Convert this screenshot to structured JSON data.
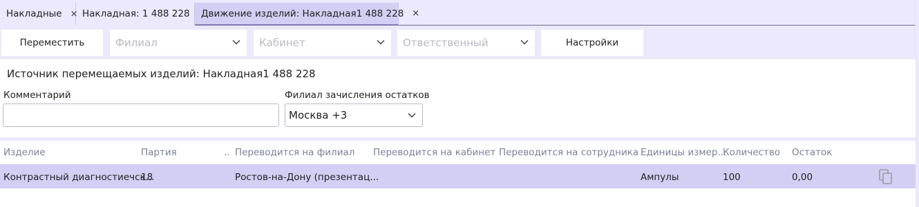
{
  "tabs": [
    {
      "label": "Накладные",
      "close": "×"
    },
    {
      "label": "Накладная: 1 488 228",
      "close": "×"
    },
    {
      "label": "Движение изделий: Накладная1 488 228",
      "close": "×"
    }
  ],
  "toolbar": {
    "move_label": "Переместить",
    "branch_placeholder": "Филиал",
    "cabinet_placeholder": "Кабинет",
    "responsible_placeholder": "Ответственный",
    "settings_label": "Настройки"
  },
  "form": {
    "source_line": "Источник перемещаемых изделий: Накладная1 488 228",
    "comment_label": "Комментарий",
    "comment_value": "",
    "branch_label": "Филиал зачисления остатков",
    "branch_value": "Москва +3"
  },
  "table": {
    "columns": [
      "Изделие",
      "Партия",
      "..",
      "Переводится на филиал",
      "Переводится на кабинет",
      "Переводится на сотрудника",
      "Единицы измер...",
      "Количество",
      "Остаток"
    ],
    "rows": [
      {
        "product": "Контрастный диагностиечск...",
        "batch": "18",
        "to_branch": "Ростов-на-Дону (презентац...",
        "to_cabinet": "",
        "to_employee": "",
        "unit": "Ампулы",
        "quantity": "100",
        "remainder": "0,00"
      }
    ]
  },
  "icons": {
    "close": "close-icon",
    "dropdown": "chevron-down-icon",
    "copy": "copy-icon"
  },
  "colors": {
    "accent": "#d3cef3",
    "background": "#ebe9fb",
    "header_text": "#7a7f9a"
  }
}
